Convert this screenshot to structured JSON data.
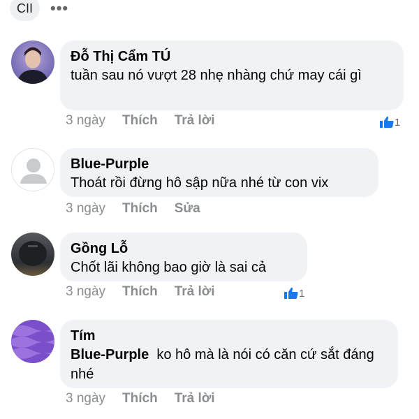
{
  "header": {
    "pill_label": "CII",
    "more_label": "•••"
  },
  "comments": [
    {
      "author": "Đỗ Thị Cẩm TÚ",
      "text": "tuần sau nó vượt 28 nhẹ nhàng chứ may cái gì",
      "time": "3 ngày",
      "like_action": "Thích",
      "second_action": "Trả lời",
      "like_count": "1"
    },
    {
      "author": "Blue-Purple",
      "text": "Thoát rồi đừng hô sập nữa nhé từ con vix",
      "time": "3 ngày",
      "like_action": "Thích",
      "second_action": "Sửa"
    },
    {
      "author": "Gồng Lỗ",
      "text": "Chốt lãi không bao giờ là sai cả",
      "time": "3 ngày",
      "like_action": "Thích",
      "second_action": "Trả lời",
      "like_count": "1"
    },
    {
      "author": "Tím",
      "mention": "Blue-Purple",
      "text": "ko hô mà là nói có căn cứ sắt đáng nhé",
      "time": "3 ngày",
      "like_action": "Thích",
      "second_action": "Trả lời"
    }
  ],
  "colors": {
    "bubble": "#f0f2f5",
    "like_blue": "#1877f2",
    "meta_gray": "#8a8d91"
  },
  "icons": [
    "user-avatar",
    "like-thumb-icon",
    "more-icon"
  ]
}
